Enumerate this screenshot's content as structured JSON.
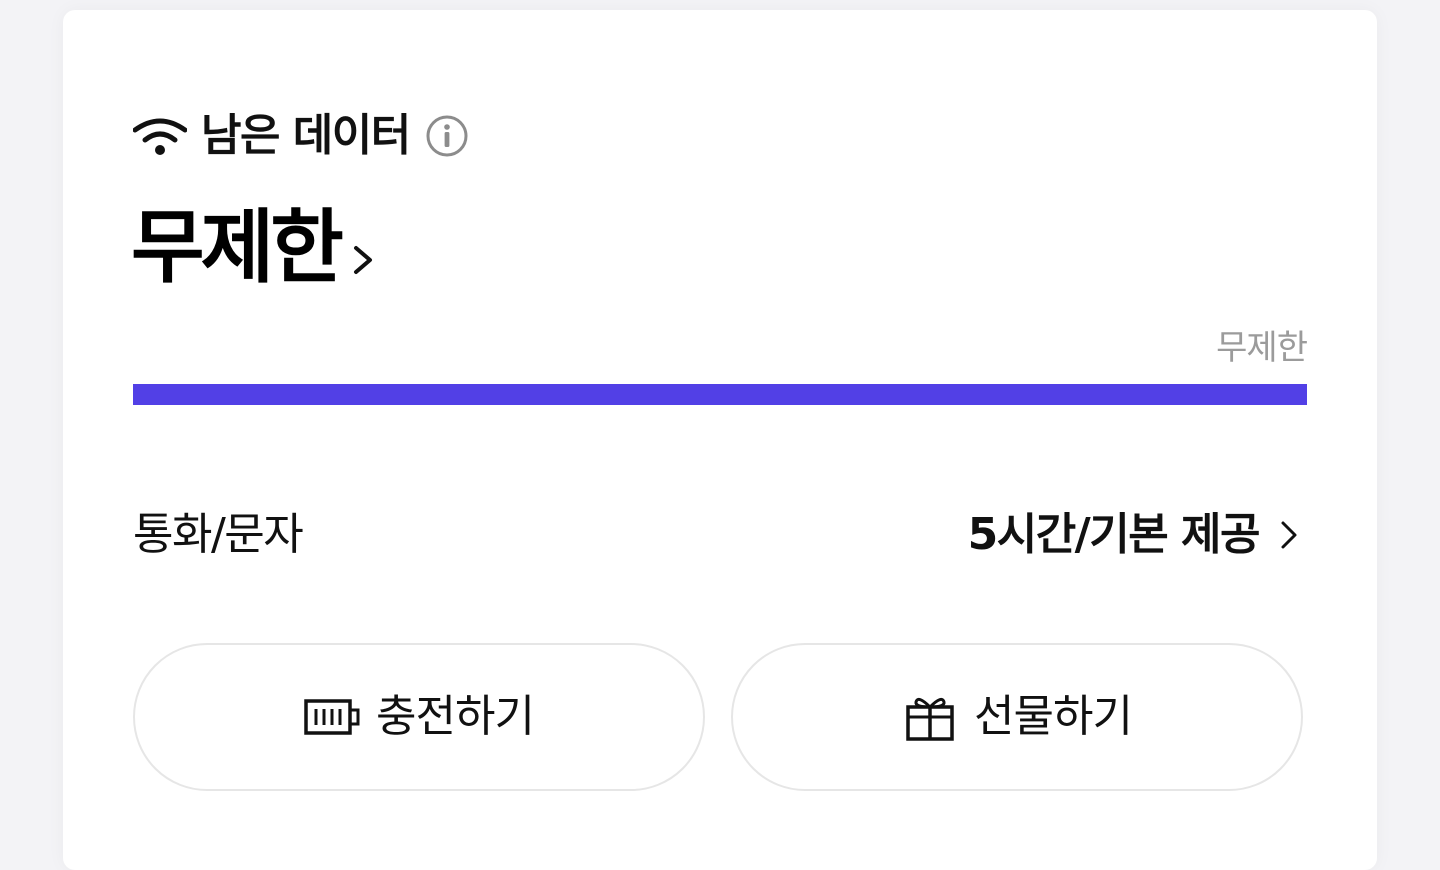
{
  "data_section": {
    "title": "남은 데이터",
    "icon": "wifi-icon",
    "info_icon": "info-icon",
    "main_value": "무제한",
    "limit_label": "무제한",
    "progress": 1.0,
    "progress_color": "#5240e6"
  },
  "call_section": {
    "label": "통화/문자",
    "value": "5시간/기본 제공"
  },
  "actions": {
    "charge_label": "충전하기",
    "charge_icon": "battery-icon",
    "gift_label": "선물하기",
    "gift_icon": "gift-icon"
  }
}
